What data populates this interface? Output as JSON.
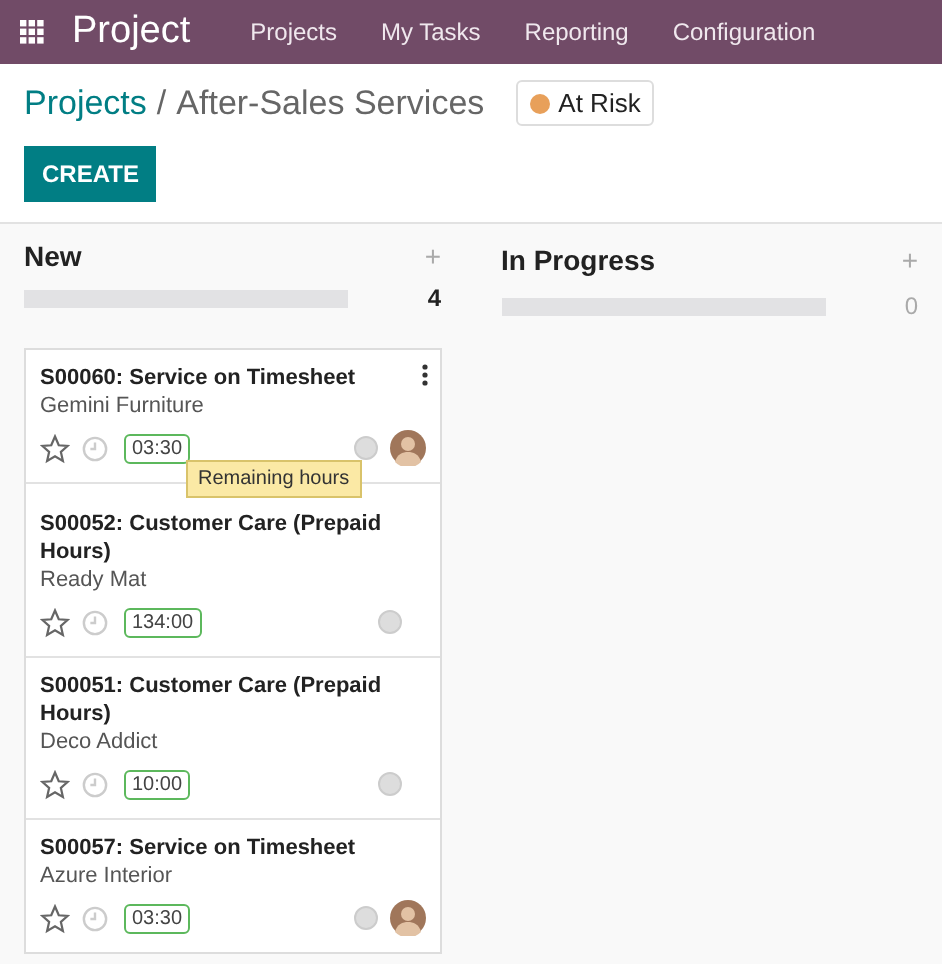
{
  "navbar": {
    "app_title": "Project",
    "menu": [
      {
        "label": "Projects"
      },
      {
        "label": "My Tasks"
      },
      {
        "label": "Reporting"
      },
      {
        "label": "Configuration"
      }
    ]
  },
  "breadcrumb": {
    "parent": "Projects",
    "separator": "/",
    "current": "After-Sales Services"
  },
  "status": {
    "label": "At Risk",
    "color": "#e8a05a"
  },
  "create_button": "CREATE",
  "columns": [
    {
      "title": "New",
      "add": "+",
      "count": "4",
      "cards": [
        {
          "title": "S00060: Service on Timesheet",
          "customer": "Gemini Furniture",
          "hours": "03:30",
          "starred": false,
          "has_avatar": true,
          "menu": true,
          "tooltip": "Remaining hours"
        },
        {
          "title": "S00052: Customer Care (Prepaid Hours)",
          "customer": "Ready Mat",
          "hours": "134:00",
          "starred": false,
          "has_avatar": false,
          "menu": false
        },
        {
          "title": "S00051: Customer Care (Prepaid Hours)",
          "customer": "Deco Addict",
          "hours": "10:00",
          "starred": false,
          "has_avatar": false,
          "menu": false
        },
        {
          "title": "S00057: Service on Timesheet",
          "customer": "Azure Interior",
          "hours": "03:30",
          "starred": false,
          "has_avatar": true,
          "menu": false
        }
      ]
    },
    {
      "title": "In Progress",
      "add": "+",
      "count": "0"
    }
  ]
}
